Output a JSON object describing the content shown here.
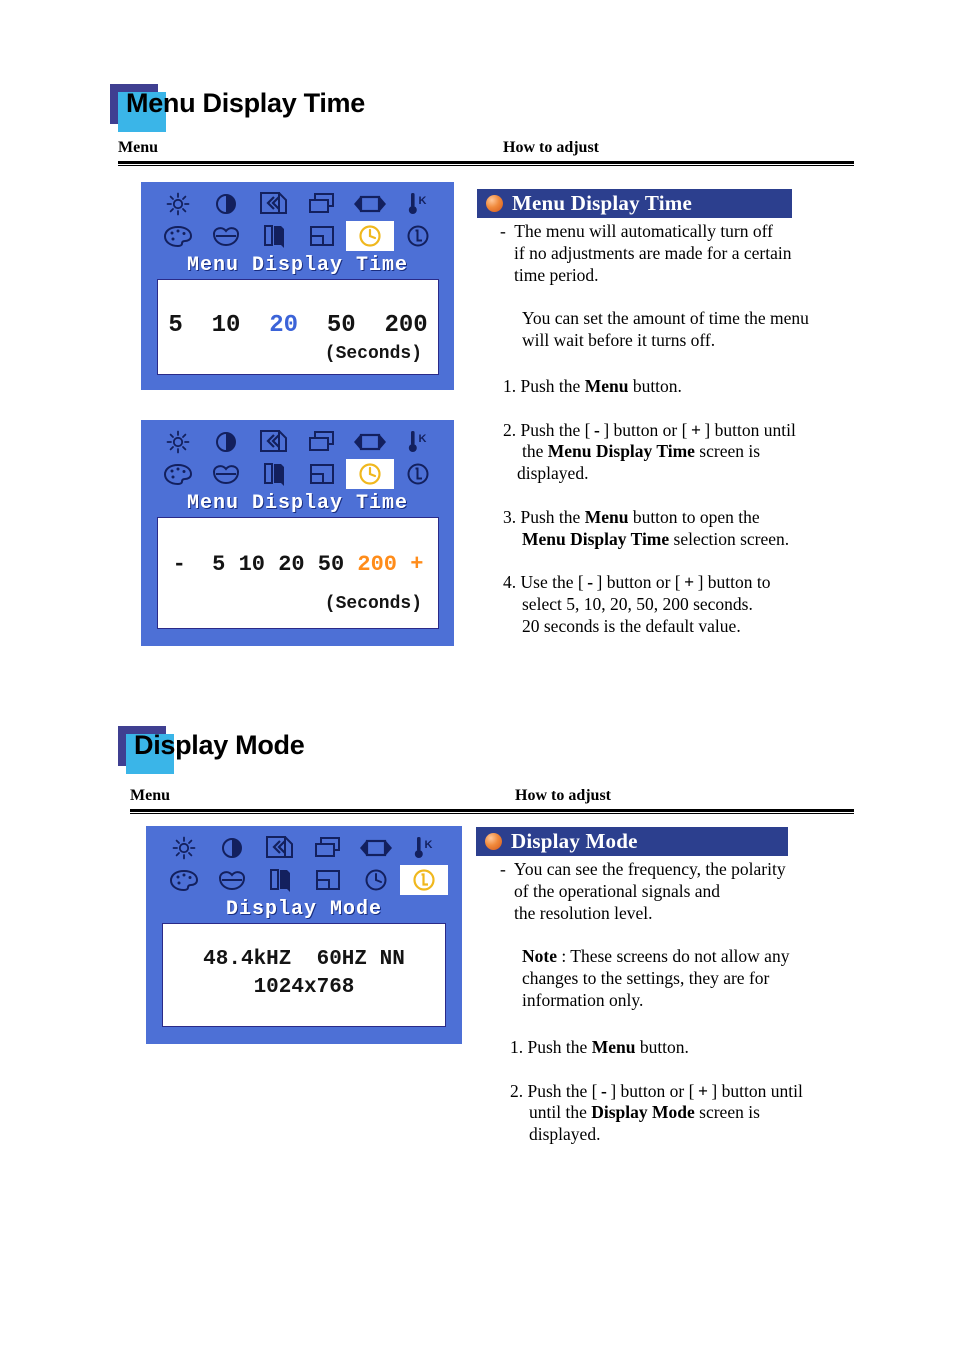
{
  "sections": [
    {
      "title": "Menu Display Time",
      "title_lead": "M",
      "columns": {
        "menu": "Menu",
        "how_to_adjust": "How to adjust"
      },
      "osd_screens": [
        {
          "name": "menu-display-time-osd-1",
          "icons_row1": [
            "brightness-icon",
            "contrast-icon",
            "image-lock-icon",
            "position-icon",
            "tracking-icon",
            "color-temperature-icon"
          ],
          "icons_row2": [
            "color-palette-icon",
            "color-control-icon",
            "sharpness-icon",
            "osd-position-icon",
            "menu-display-time-icon",
            "information-icon"
          ],
          "selected_icon": "menu-display-time-icon",
          "title": "Menu Display Time",
          "values": [
            "5",
            "10",
            "20",
            "50",
            "200"
          ],
          "highlighted_value": "20",
          "highlight_color": "#3b63d8",
          "unit_label": "(Seconds)",
          "has_minus_plus": false
        },
        {
          "name": "menu-display-time-osd-2",
          "icons_row1": [
            "brightness-icon",
            "contrast-icon",
            "image-lock-icon",
            "position-icon",
            "tracking-icon",
            "color-temperature-icon"
          ],
          "icons_row2": [
            "color-palette-icon",
            "color-control-icon",
            "sharpness-icon",
            "osd-position-icon",
            "menu-display-time-icon",
            "information-icon"
          ],
          "selected_icon": "menu-display-time-icon",
          "title": "Menu Display Time",
          "minus_label": "-",
          "plus_label": "+",
          "values": [
            "5",
            "10",
            "20",
            "50",
            "200"
          ],
          "highlighted_value": "200",
          "highlight_color": "#ff8c1a",
          "unit_label": "(Seconds)",
          "has_minus_plus": true
        }
      ],
      "howto": {
        "bar_title": "Menu Display Time",
        "bullet": "orange-sphere-bullet",
        "paragraphs": [
          {
            "type": "dash",
            "lines": [
              "-  The menu will automatically turn off",
              "if no adjustments are made for a certain",
              "time period."
            ]
          },
          {
            "type": "plain",
            "lines": [
              "You can set the amount of time the menu",
              "will wait before it turns off."
            ]
          },
          {
            "type": "step",
            "number": "1.",
            "lines": [
              "1. Push the Menu button."
            ]
          },
          {
            "type": "step",
            "number": "2.",
            "lines": [
              "2. Push the [ - ] button or [ + ] button until",
              "the Menu Display Time screen is",
              "displayed."
            ]
          },
          {
            "type": "step",
            "number": "3.",
            "lines": [
              "3. Push the Menu button to open the",
              "Menu Display Time selection screen."
            ]
          },
          {
            "type": "step",
            "number": "4.",
            "lines": [
              "4. Use the [ - ] button or [ + ] button to",
              "select 5, 10, 20, 50, 200 seconds.",
              "20 seconds is the default value."
            ]
          }
        ]
      }
    },
    {
      "title": "Display Mode",
      "title_lead": "Di",
      "columns": {
        "menu": "Menu",
        "how_to_adjust": "How to adjust"
      },
      "osd_screens": [
        {
          "name": "display-mode-osd",
          "icons_row1": [
            "brightness-icon",
            "contrast-icon",
            "image-lock-icon",
            "position-icon",
            "tracking-icon",
            "color-temperature-icon"
          ],
          "icons_row2": [
            "color-palette-icon",
            "color-control-icon",
            "sharpness-icon",
            "osd-position-icon",
            "menu-display-time-icon",
            "information-icon"
          ],
          "selected_icon": "information-icon",
          "title": "Display Mode",
          "line1": "48.4kHZ  60HZ NN",
          "line2": "1024x768"
        }
      ],
      "howto": {
        "bar_title": "Display Mode",
        "bullet": "orange-sphere-bullet",
        "paragraphs": [
          {
            "type": "dash",
            "lines": [
              "-  You can see the frequency, the polarity",
              "of the operational signals and",
              "the resolution level."
            ]
          },
          {
            "type": "note",
            "lines": [
              "Note : These screens do not allow any",
              "changes to the settings, they are for",
              "information only."
            ]
          },
          {
            "type": "step",
            "number": "1.",
            "lines": [
              "1. Push the Menu button."
            ]
          },
          {
            "type": "step",
            "number": "2.",
            "lines": [
              "2. Push the [ - ] button or [ + ] button until",
              "until the Display Mode screen is",
              "displayed."
            ]
          }
        ]
      }
    }
  ],
  "colors": {
    "osd_background": "#4d70d6",
    "osd_panel": "#ffffff",
    "header_bar": "#2c3f8e",
    "title_square_back": "#3f3f91",
    "title_square_front": "#3ab5e8",
    "accent_orange": "#ff8c1a",
    "accent_blue": "#3b63d8",
    "highlight_yellow": "#f0b81e"
  }
}
